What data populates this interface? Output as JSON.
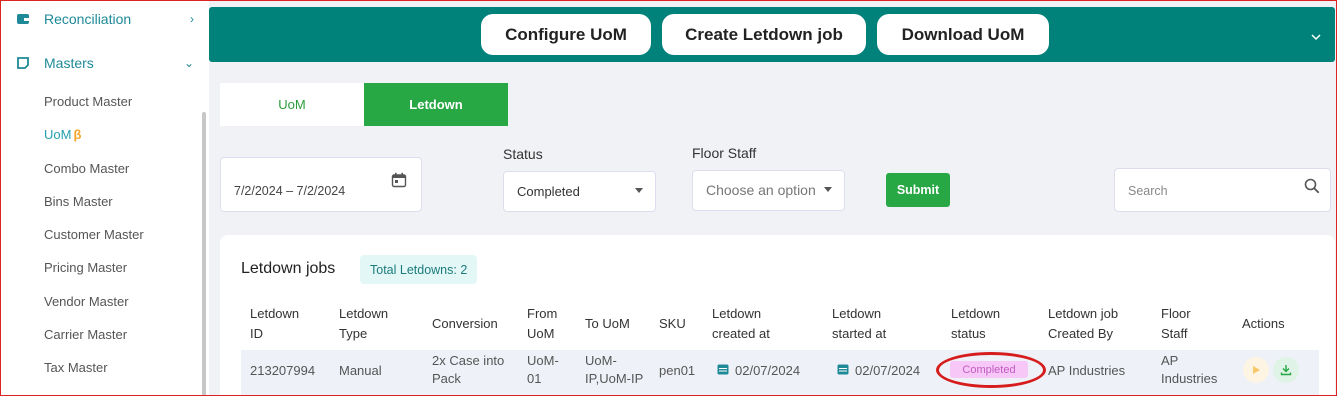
{
  "sidebar": {
    "groups": [
      {
        "label": "Reconciliation",
        "icon": "wallet-icon",
        "chevron": "›"
      },
      {
        "label": "Masters",
        "icon": "note-icon",
        "chevron": "⌄"
      }
    ],
    "items": [
      {
        "label": "Product Master"
      },
      {
        "label": "UoM",
        "beta": "β"
      },
      {
        "label": "Combo Master"
      },
      {
        "label": "Bins Master"
      },
      {
        "label": "Customer Master"
      },
      {
        "label": "Pricing Master"
      },
      {
        "label": "Vendor Master"
      },
      {
        "label": "Carrier Master"
      },
      {
        "label": "Tax Master"
      }
    ]
  },
  "topbar": {
    "buttons": [
      "Configure UoM",
      "Create Letdown job",
      "Download UoM"
    ],
    "collapse_icon": "chevron-down-icon"
  },
  "tabs": [
    "UoM",
    "Letdown"
  ],
  "filters": {
    "date_range": "7/2/2024 – 7/2/2024",
    "status_label": "Status",
    "status_value": "Completed",
    "floor_staff_label": "Floor Staff",
    "floor_staff_placeholder": "Choose an option",
    "submit_label": "Submit",
    "search_placeholder": "Search"
  },
  "card": {
    "title": "Letdown jobs",
    "total_badge": "Total Letdowns: 2"
  },
  "table": {
    "headers": [
      [
        "Letdown",
        "ID"
      ],
      [
        "Letdown",
        "Type"
      ],
      [
        "Conversion"
      ],
      [
        "From",
        "UoM"
      ],
      [
        "To UoM"
      ],
      [
        "SKU"
      ],
      [
        "Letdown",
        "created at"
      ],
      [
        "Letdown",
        "started at"
      ],
      [
        "Letdown",
        "status"
      ],
      [
        "Letdown job",
        "Created By"
      ],
      [
        "Floor",
        "Staff"
      ],
      [
        "Actions"
      ]
    ],
    "rows": [
      {
        "id": "213207994",
        "type": "Manual",
        "conversion": [
          "2x Case into",
          "Pack"
        ],
        "from_uom": [
          "UoM-",
          "01"
        ],
        "to_uom": [
          "UoM-",
          "IP,UoM-IP"
        ],
        "sku": "pen01",
        "created_at": "02/07/2024",
        "started_at": "02/07/2024",
        "status": "Completed",
        "created_by": "AP Industries",
        "floor_staff": [
          "AP",
          "Industries"
        ]
      }
    ]
  },
  "colors": {
    "topbar": "#00827a",
    "green": "#28a745",
    "teal_text": "#1e8a97",
    "status_badge_bg": "#f7c7f7",
    "highlight_ellipse": "#d61c1c"
  }
}
